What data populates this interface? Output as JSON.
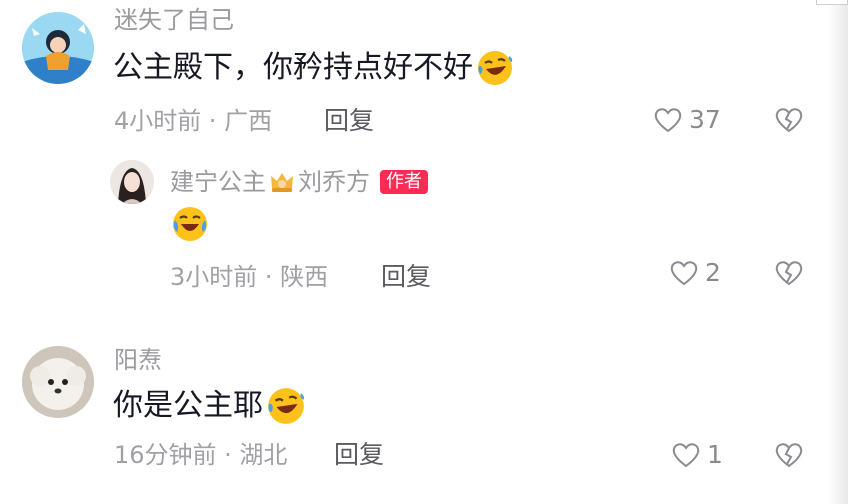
{
  "comments": [
    {
      "username": "迷失了自己",
      "text": "公主殿下，你矜持点好不好",
      "emoji": "laughing-crying-emoji",
      "time_location": "4小时前 · 广西",
      "reply_label": "回复",
      "like_count": "37"
    },
    {
      "username": "阳焘",
      "text": "你是公主耶",
      "emoji": "laughing-crying-emoji",
      "time_location": "16分钟前 · 湖北",
      "reply_label": "回复",
      "like_count": "1"
    }
  ],
  "reply": {
    "username": "建宁公主",
    "crown_icon": "crown-icon",
    "username_suffix": "刘乔方",
    "badge": "作者",
    "emoji": "laughing-crying-emoji",
    "time_location": "3小时前 · 陕西",
    "reply_label": "回复",
    "like_count": "2"
  },
  "colors": {
    "badge_bg": "#fe2c55",
    "text_primary": "#161823",
    "text_secondary": "#9a9a9f"
  }
}
